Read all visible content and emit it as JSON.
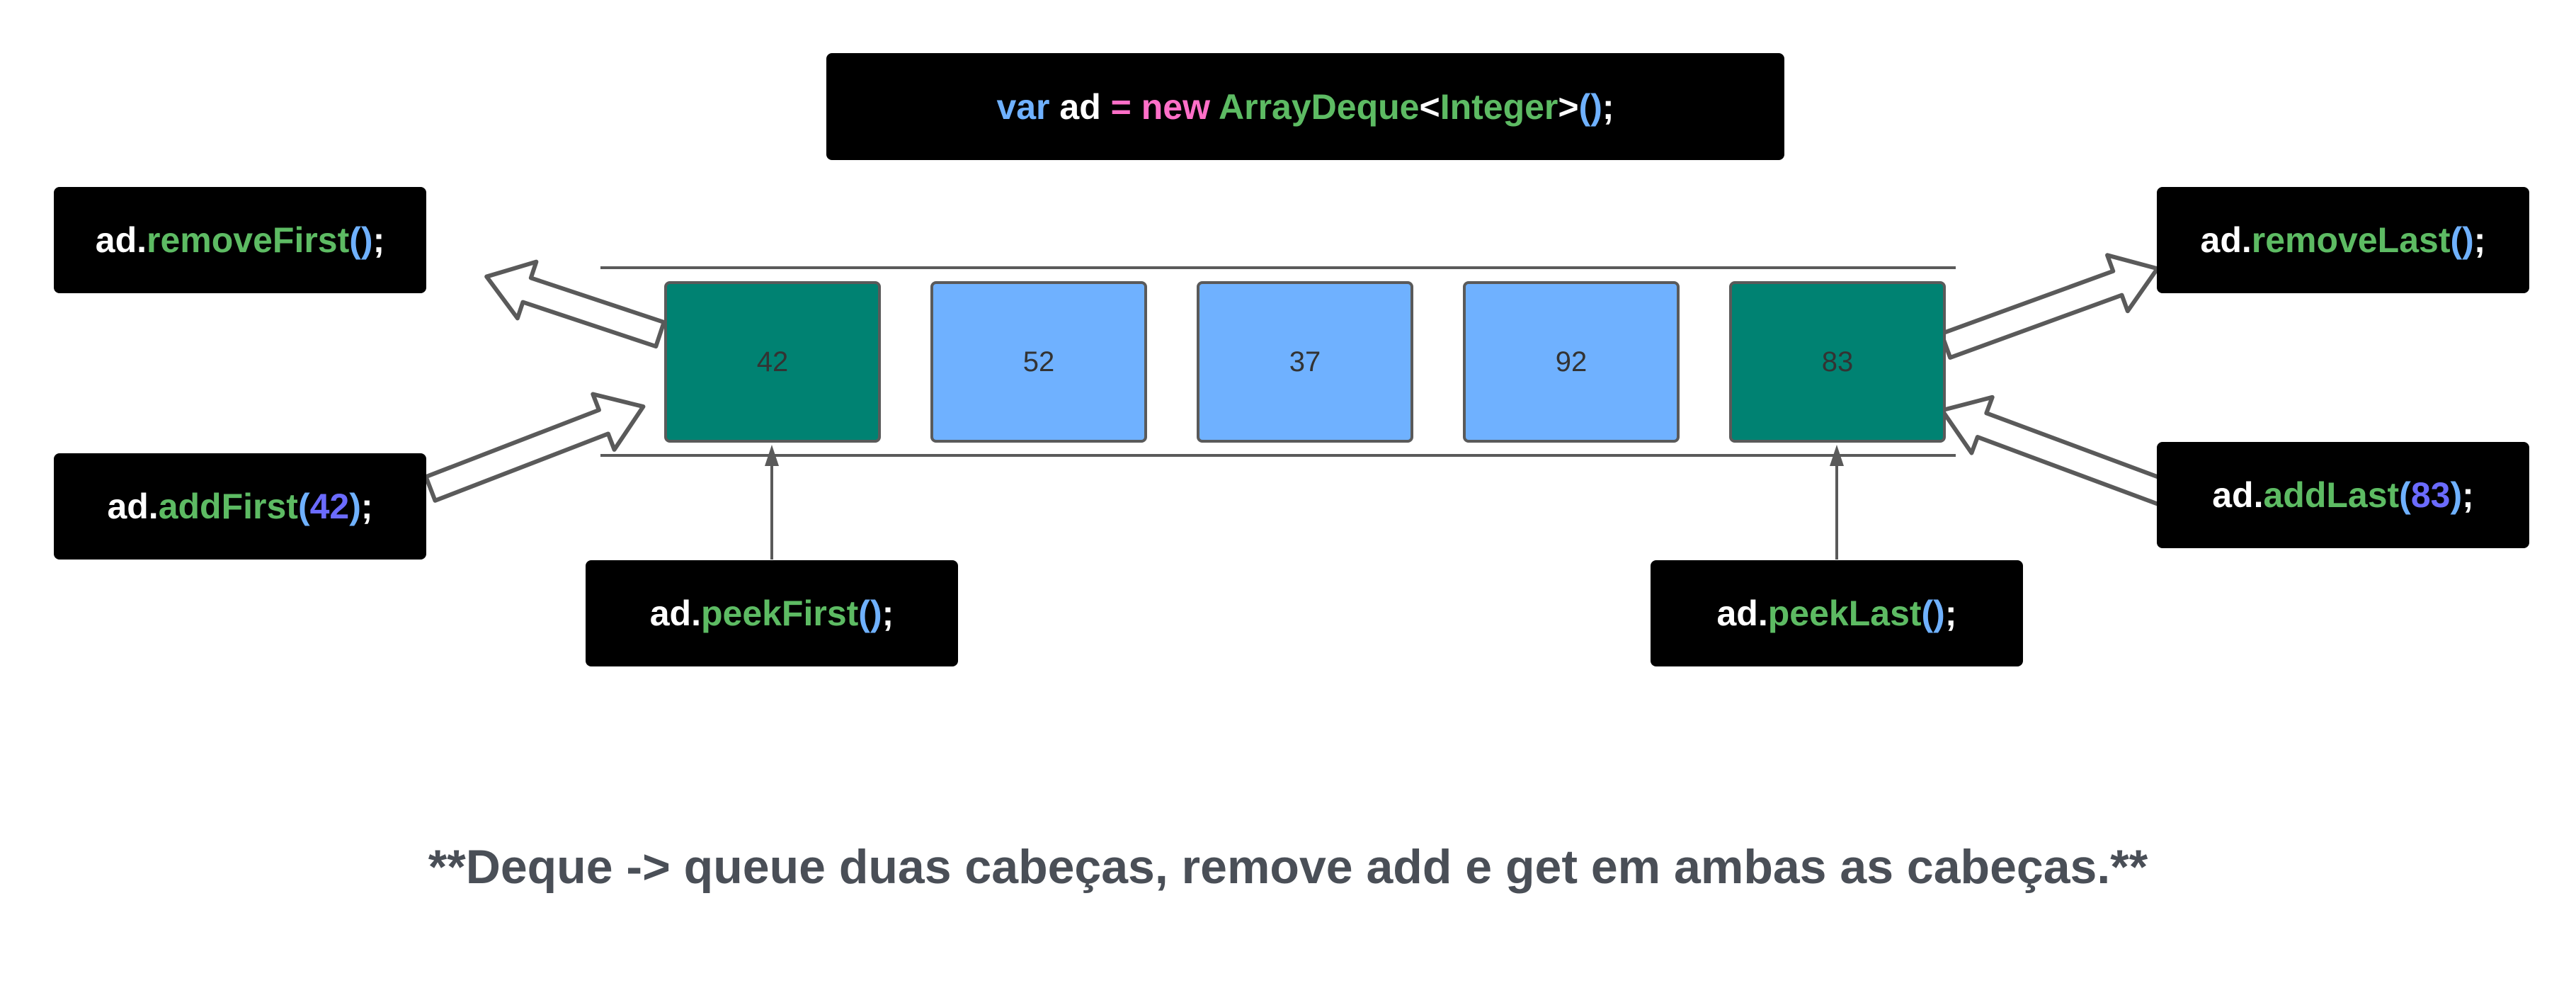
{
  "constructor_line": [
    {
      "text": "var",
      "color": "blue"
    },
    {
      "text": " ad ",
      "color": "white"
    },
    {
      "text": "= new",
      "color": "pink"
    },
    {
      "text": " ArrayDeque",
      "color": "green"
    },
    {
      "text": "<",
      "color": "white"
    },
    {
      "text": "Integer",
      "color": "green"
    },
    {
      "text": ">",
      "color": "white"
    },
    {
      "text": "()",
      "color": "blue"
    },
    {
      "text": ";",
      "color": "white"
    }
  ],
  "operations": {
    "remove_first": [
      {
        "text": "ad.",
        "color": "white"
      },
      {
        "text": "removeFirst",
        "color": "green"
      },
      {
        "text": "()",
        "color": "blue"
      },
      {
        "text": ";",
        "color": "white"
      }
    ],
    "add_first": [
      {
        "text": "ad.",
        "color": "white"
      },
      {
        "text": "addFirst",
        "color": "green"
      },
      {
        "text": "(",
        "color": "blue"
      },
      {
        "text": "42",
        "color": "purple"
      },
      {
        "text": ")",
        "color": "blue"
      },
      {
        "text": ";",
        "color": "white"
      }
    ],
    "peek_first": [
      {
        "text": "ad.",
        "color": "white"
      },
      {
        "text": "peekFirst",
        "color": "green"
      },
      {
        "text": "()",
        "color": "blue"
      },
      {
        "text": ";",
        "color": "white"
      }
    ],
    "remove_last": [
      {
        "text": "ad.",
        "color": "white"
      },
      {
        "text": "removeLast",
        "color": "green"
      },
      {
        "text": "()",
        "color": "blue"
      },
      {
        "text": ";",
        "color": "white"
      }
    ],
    "add_last": [
      {
        "text": "ad.",
        "color": "white"
      },
      {
        "text": "addLast",
        "color": "green"
      },
      {
        "text": "(",
        "color": "blue"
      },
      {
        "text": "83",
        "color": "purple"
      },
      {
        "text": ")",
        "color": "blue"
      },
      {
        "text": ";",
        "color": "white"
      }
    ],
    "peek_last": [
      {
        "text": "ad.",
        "color": "white"
      },
      {
        "text": "peekLast",
        "color": "green"
      },
      {
        "text": "()",
        "color": "blue"
      },
      {
        "text": ";",
        "color": "white"
      }
    ]
  },
  "deque": {
    "elements": [
      {
        "value": "42",
        "role": "head"
      },
      {
        "value": "52",
        "role": "middle"
      },
      {
        "value": "37",
        "role": "middle"
      },
      {
        "value": "92",
        "role": "middle"
      },
      {
        "value": "83",
        "role": "tail"
      }
    ]
  },
  "colors": {
    "end_cell": "#008272",
    "middle_cell": "#6fb1ff",
    "code_background": "#000000",
    "arrow_stroke": "#5a5a5a",
    "caption": "#4a4f57"
  },
  "caption": "**Deque -> queue duas cabeças, remove add e get em ambas as cabeças.**"
}
